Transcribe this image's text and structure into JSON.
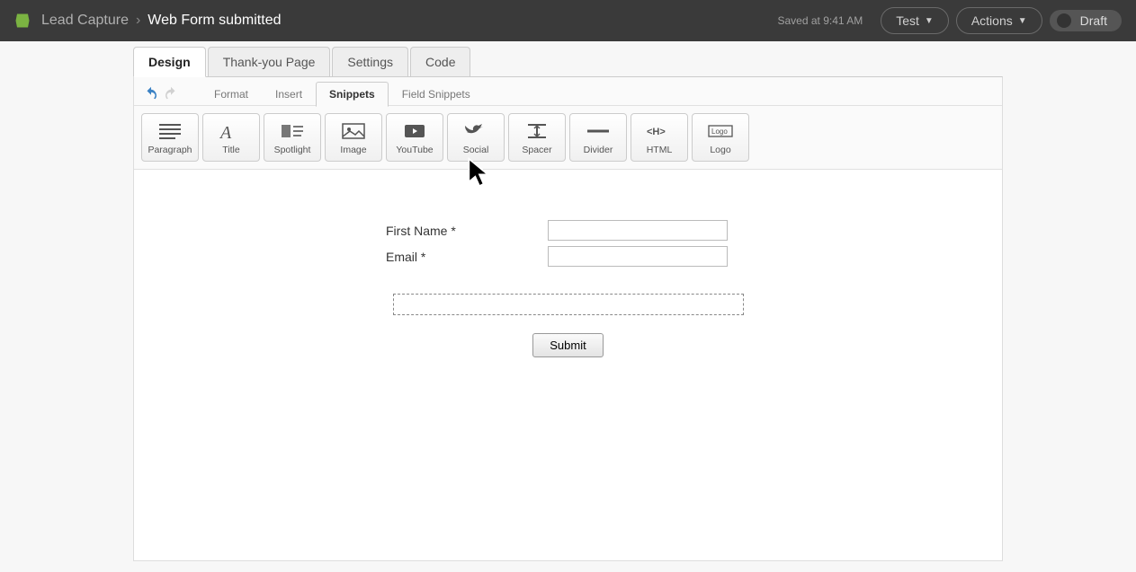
{
  "header": {
    "breadcrumb_parent": "Lead Capture",
    "breadcrumb_sep": "›",
    "breadcrumb_current": "Web Form submitted",
    "saved_text": "Saved at 9:41 AM",
    "test_label": "Test",
    "actions_label": "Actions",
    "status_label": "Draft"
  },
  "main_tabs": {
    "design": "Design",
    "thankyou": "Thank-you Page",
    "settings": "Settings",
    "code": "Code"
  },
  "sub_tabs": {
    "format": "Format",
    "insert": "Insert",
    "snippets": "Snippets",
    "field_snippets": "Field Snippets"
  },
  "snippets": {
    "paragraph": "Paragraph",
    "title": "Title",
    "spotlight": "Spotlight",
    "image": "Image",
    "youtube": "YouTube",
    "social": "Social",
    "spacer": "Spacer",
    "divider": "Divider",
    "html": "HTML",
    "logo": "Logo"
  },
  "form": {
    "first_name_label": "First Name *",
    "email_label": "Email *",
    "submit_label": "Submit"
  }
}
